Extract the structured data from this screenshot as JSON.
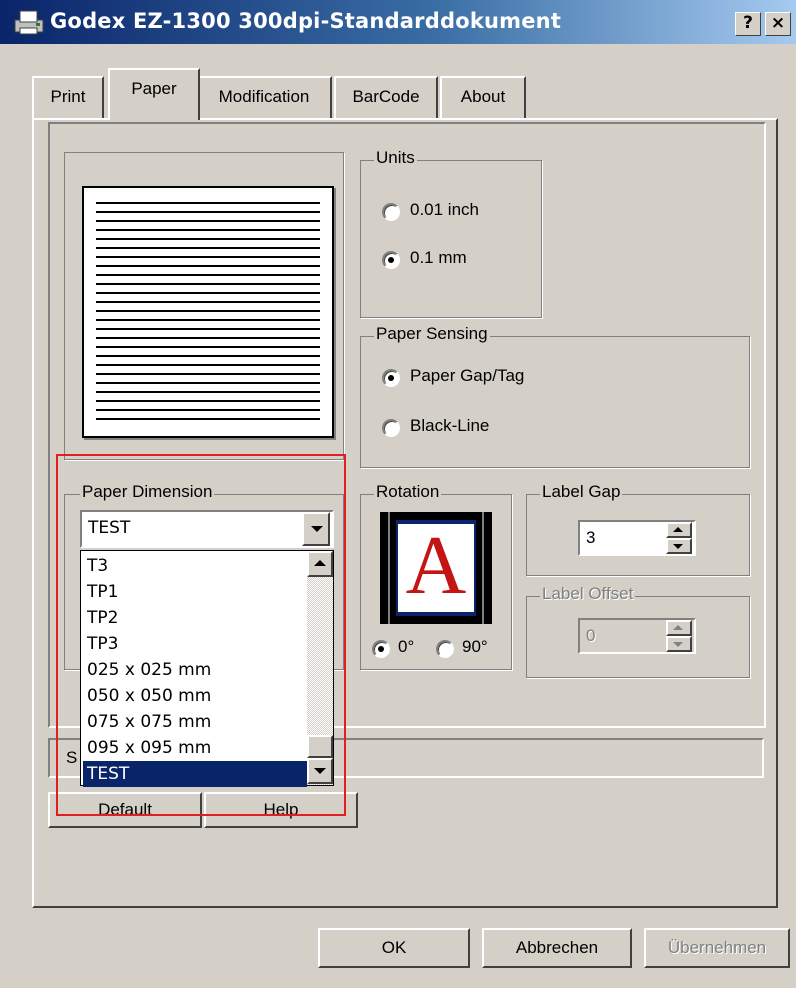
{
  "window": {
    "title": "Godex EZ-1300 300dpi-Standarddokument",
    "help_button": "?",
    "close_button": "×"
  },
  "tabs": [
    {
      "label": "Print"
    },
    {
      "label": "Paper"
    },
    {
      "label": "Modification"
    },
    {
      "label": "BarCode"
    },
    {
      "label": "About"
    }
  ],
  "active_tab": "Paper",
  "units": {
    "group_label": "Units",
    "options": [
      {
        "label": "0.01 inch",
        "checked": false
      },
      {
        "label": "0.1 mm",
        "checked": true
      }
    ]
  },
  "paper_sensing": {
    "group_label": "Paper Sensing",
    "options": [
      {
        "label": "Paper Gap/Tag",
        "checked": true
      },
      {
        "label": "Black-Line",
        "checked": false
      }
    ]
  },
  "paper_dimension": {
    "group_label": "Paper Dimension",
    "selected_value": "TEST",
    "list_items": [
      "T3",
      "TP1",
      "TP2",
      "TP3",
      "025 x 025 mm",
      "050 x 050 mm",
      "075 x 075 mm",
      "095 x 095 mm",
      "TEST"
    ],
    "selected_index": 8
  },
  "rotation": {
    "group_label": "Rotation",
    "preview_letter": "A",
    "options": [
      {
        "label": "0°",
        "checked": true
      },
      {
        "label": "90°",
        "checked": false
      }
    ]
  },
  "label_gap": {
    "group_label": "Label Gap",
    "value": "3"
  },
  "label_offset": {
    "group_label": "Label Offset",
    "value": "0",
    "disabled": true
  },
  "status_bar": {
    "partial_text": "S"
  },
  "panel_buttons": {
    "default": "Default",
    "help": "Help"
  },
  "dialog_buttons": {
    "ok": "OK",
    "cancel": "Abbrechen",
    "apply": "Übernehmen",
    "apply_disabled": true
  },
  "highlight": {
    "color": "#e02020",
    "target": "paper-dimension"
  }
}
